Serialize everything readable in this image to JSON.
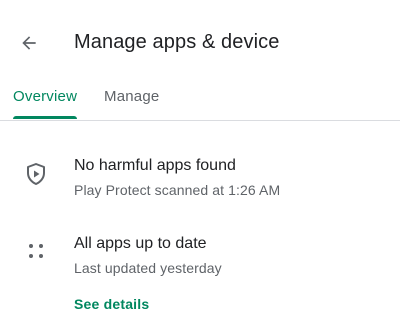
{
  "appbar": {
    "title": "Manage apps & device",
    "back_icon": "arrow-back-icon"
  },
  "tabs": [
    {
      "label": "Overview",
      "selected": true
    },
    {
      "label": "Manage",
      "selected": false
    }
  ],
  "colors": {
    "accent": "#01875f",
    "text_primary": "#202124",
    "text_secondary": "#5f6368",
    "divider": "#dadce0"
  },
  "play_protect": {
    "icon": "shield-play-icon",
    "title": "No harmful apps found",
    "subtitle": "Play Protect scanned at 1:26 AM"
  },
  "updates": {
    "icon": "apps-grid-icon",
    "title": "All apps up to date",
    "subtitle": "Last updated yesterday",
    "link": "See details"
  }
}
